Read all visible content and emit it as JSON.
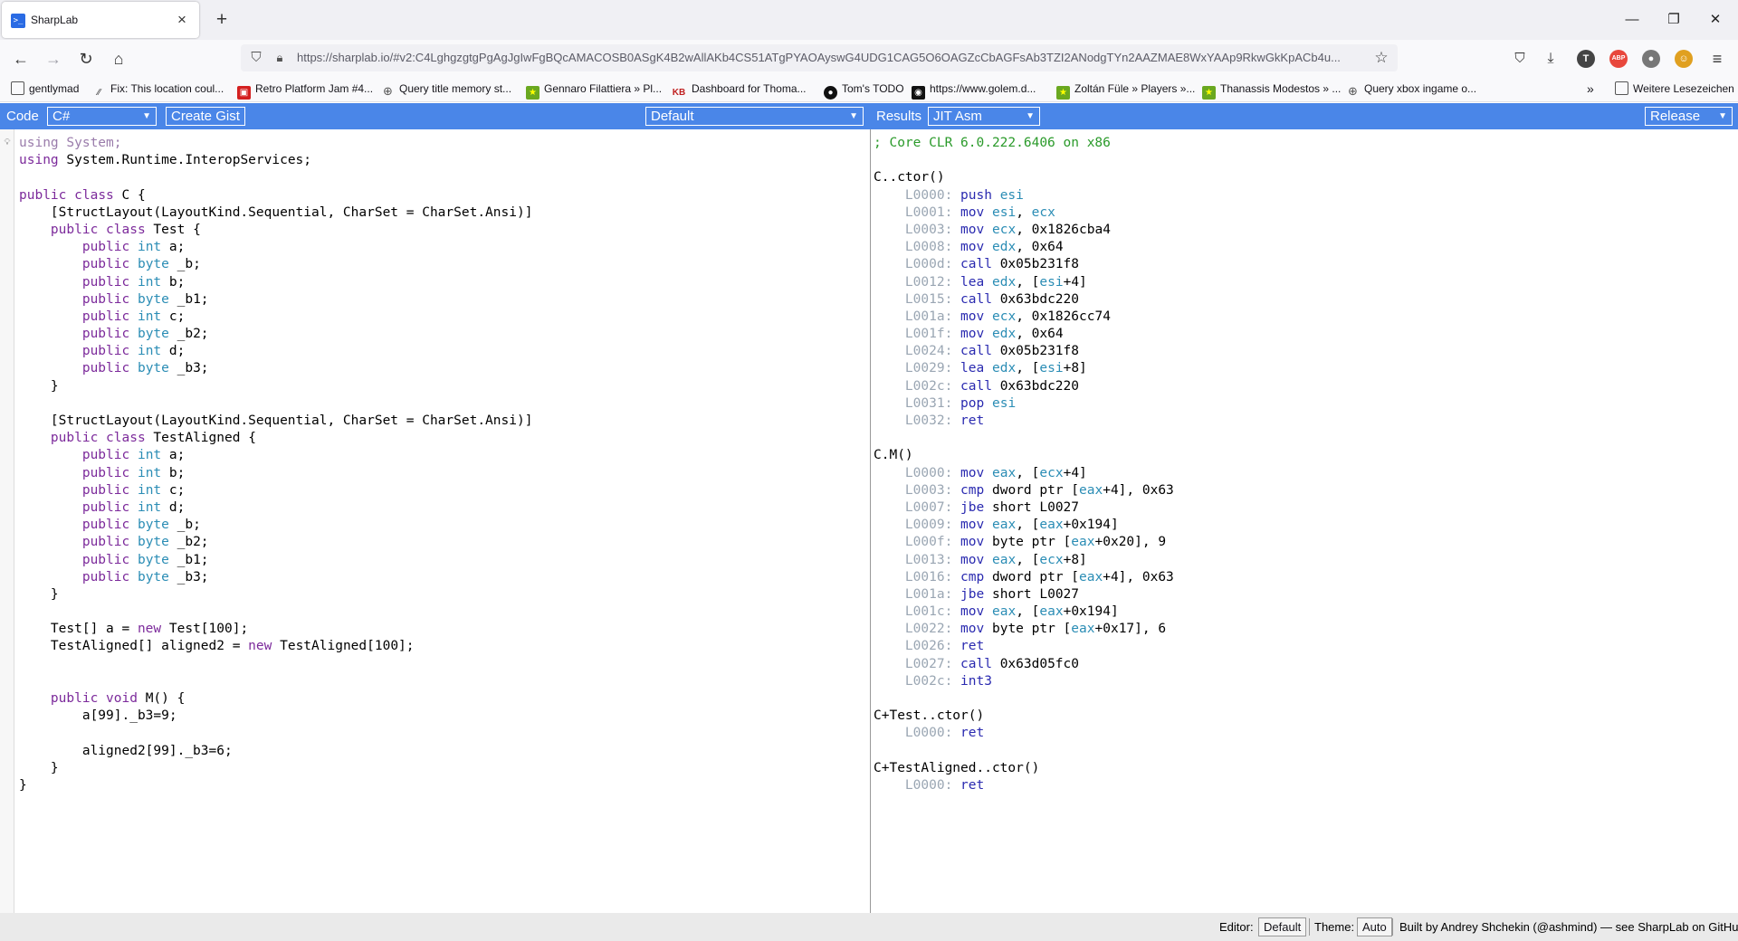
{
  "browser": {
    "tab_title": "SharpLab",
    "url": "https://sharplab.io/#v2:C4LghgzgtgPgAgJgIwFgBQcAMACOSB0ASgK4B2wAllAKb4CS51ATgPYAOAyswG4UDG1CAG5O6OAGZcCbAGFsAb3TZI2ANodgTYn2AAZMAE8WxYAAp9RkwGkKpACb4u..."
  },
  "bookmarks": [
    {
      "label": "gentlymad"
    },
    {
      "label": "Fix: This location coul..."
    },
    {
      "label": "Retro Platform Jam #4..."
    },
    {
      "label": "Query title memory st..."
    },
    {
      "label": "Gennaro Filattiera » Pl..."
    },
    {
      "label": "Dashboard for Thoma..."
    },
    {
      "label": "Tom's TODO"
    },
    {
      "label": "https://www.golem.d..."
    },
    {
      "label": "Zoltán Füle » Players »..."
    },
    {
      "label": "Thanassis Modestos » ..."
    },
    {
      "label": "Query xbox ingame o..."
    }
  ],
  "bookmarks_more": "Weitere Lesezeichen",
  "toolbar": {
    "code_label": "Code",
    "language": "C#",
    "create_gist": "Create Gist",
    "branch": "Default",
    "results_label": "Results",
    "output": "JIT Asm",
    "mode": "Release"
  },
  "code": [
    "using System;",
    "using System.Runtime.InteropServices;",
    "",
    "public class C {",
    "    [StructLayout(LayoutKind.Sequential, CharSet = CharSet.Ansi)]",
    "    public class Test {",
    "        public int a;",
    "        public byte _b;",
    "        public int b;",
    "        public byte _b1;",
    "        public int c;",
    "        public byte _b2;",
    "        public int d;",
    "        public byte _b3;",
    "    }",
    "",
    "    [StructLayout(LayoutKind.Sequential, CharSet = CharSet.Ansi)]",
    "    public class TestAligned {",
    "        public int a;",
    "        public int b;",
    "        public int c;",
    "        public int d;",
    "        public byte _b;",
    "        public byte _b2;",
    "        public byte _b1;",
    "        public byte _b3;",
    "    }",
    "",
    "    Test[] a = new Test[100];",
    "    TestAligned[] aligned2 = new TestAligned[100];",
    "",
    "",
    "    public void M() {",
    "        a[99]._b3=9;",
    "",
    "        aligned2[99]._b3=6;",
    "    }",
    "}"
  ],
  "asm": [
    {
      "t": "comment",
      "text": "; Core CLR 6.0.222.6406 on x86"
    },
    {
      "t": "blank"
    },
    {
      "t": "head",
      "text": "C..ctor()"
    },
    {
      "t": "ins",
      "label": "L0000:",
      "op": "push",
      "args": "esi"
    },
    {
      "t": "ins",
      "label": "L0001:",
      "op": "mov",
      "args": "esi, ecx"
    },
    {
      "t": "ins",
      "label": "L0003:",
      "op": "mov",
      "args": "ecx, 0x1826cba4"
    },
    {
      "t": "ins",
      "label": "L0008:",
      "op": "mov",
      "args": "edx, 0x64"
    },
    {
      "t": "ins",
      "label": "L000d:",
      "op": "call",
      "args": "0x05b231f8"
    },
    {
      "t": "ins",
      "label": "L0012:",
      "op": "lea",
      "args": "edx, [esi+4]"
    },
    {
      "t": "ins",
      "label": "L0015:",
      "op": "call",
      "args": "0x63bdc220"
    },
    {
      "t": "ins",
      "label": "L001a:",
      "op": "mov",
      "args": "ecx, 0x1826cc74"
    },
    {
      "t": "ins",
      "label": "L001f:",
      "op": "mov",
      "args": "edx, 0x64"
    },
    {
      "t": "ins",
      "label": "L0024:",
      "op": "call",
      "args": "0x05b231f8"
    },
    {
      "t": "ins",
      "label": "L0029:",
      "op": "lea",
      "args": "edx, [esi+8]"
    },
    {
      "t": "ins",
      "label": "L002c:",
      "op": "call",
      "args": "0x63bdc220"
    },
    {
      "t": "ins",
      "label": "L0031:",
      "op": "pop",
      "args": "esi"
    },
    {
      "t": "ins",
      "label": "L0032:",
      "op": "ret",
      "args": ""
    },
    {
      "t": "blank"
    },
    {
      "t": "head",
      "text": "C.M()"
    },
    {
      "t": "ins",
      "label": "L0000:",
      "op": "mov",
      "args": "eax, [ecx+4]"
    },
    {
      "t": "ins",
      "label": "L0003:",
      "op": "cmp",
      "args": "dword ptr [eax+4], 0x63"
    },
    {
      "t": "ins",
      "label": "L0007:",
      "op": "jbe",
      "args": "short L0027"
    },
    {
      "t": "ins",
      "label": "L0009:",
      "op": "mov",
      "args": "eax, [eax+0x194]"
    },
    {
      "t": "ins",
      "label": "L000f:",
      "op": "mov",
      "args": "byte ptr [eax+0x20], 9"
    },
    {
      "t": "ins",
      "label": "L0013:",
      "op": "mov",
      "args": "eax, [ecx+8]"
    },
    {
      "t": "ins",
      "label": "L0016:",
      "op": "cmp",
      "args": "dword ptr [eax+4], 0x63"
    },
    {
      "t": "ins",
      "label": "L001a:",
      "op": "jbe",
      "args": "short L0027"
    },
    {
      "t": "ins",
      "label": "L001c:",
      "op": "mov",
      "args": "eax, [eax+0x194]"
    },
    {
      "t": "ins",
      "label": "L0022:",
      "op": "mov",
      "args": "byte ptr [eax+0x17], 6"
    },
    {
      "t": "ins",
      "label": "L0026:",
      "op": "ret",
      "args": ""
    },
    {
      "t": "ins",
      "label": "L0027:",
      "op": "call",
      "args": "0x63d05fc0"
    },
    {
      "t": "ins",
      "label": "L002c:",
      "op": "int3",
      "args": ""
    },
    {
      "t": "blank"
    },
    {
      "t": "head",
      "text": "C+Test..ctor()"
    },
    {
      "t": "ins",
      "label": "L0000:",
      "op": "ret",
      "args": ""
    },
    {
      "t": "blank"
    },
    {
      "t": "head",
      "text": "C+TestAligned..ctor()"
    },
    {
      "t": "ins",
      "label": "L0000:",
      "op": "ret",
      "args": ""
    }
  ],
  "footer": {
    "editor_label": "Editor:",
    "editor_value": "Default",
    "theme_label": "Theme:",
    "theme_value": "Auto",
    "credits": "Built by Andrey Shchekin (@ashmind) — see SharpLab on GitHub."
  },
  "colors": {
    "accent": "#4a86e8",
    "keyword": "#7c2a9b",
    "type": "#2b8db5",
    "comment": "#2a9a2a",
    "instruction": "#2a2ab0"
  }
}
